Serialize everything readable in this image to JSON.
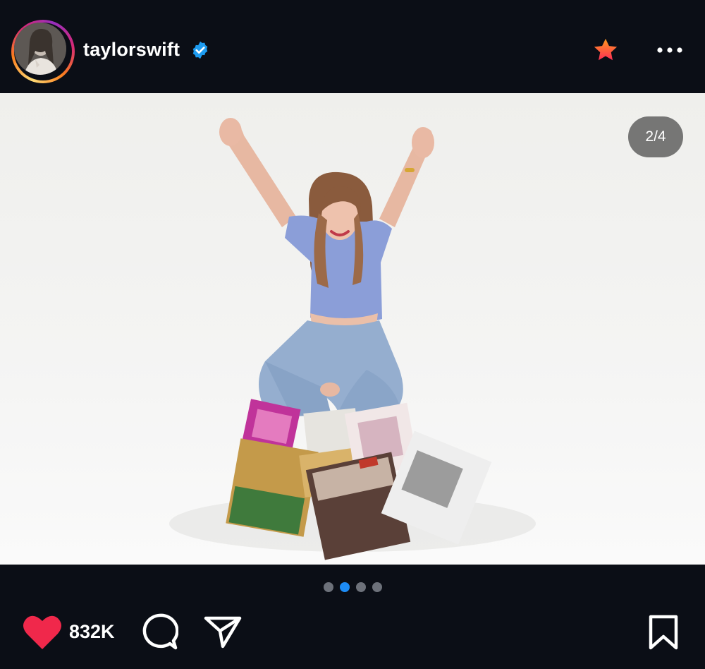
{
  "post": {
    "username": "taylorswift",
    "verified": true,
    "slide_counter": "2/4",
    "total_slides": 4,
    "active_slide": 2,
    "likes": "832K"
  },
  "icons": {
    "verified": "verified-badge-icon",
    "star": "favorite-star-icon",
    "more": "more-options-icon",
    "like": "heart-icon",
    "comment": "comment-icon",
    "share": "share-icon",
    "save": "bookmark-icon"
  },
  "colors": {
    "background": "#0b0e16",
    "like": "#f0284b",
    "verified": "#1d9bf0",
    "active_dot": "#1d8cf6",
    "inactive_dot": "#6d717a",
    "star_start": "#ff9a1f",
    "star_end": "#ff2d55"
  }
}
